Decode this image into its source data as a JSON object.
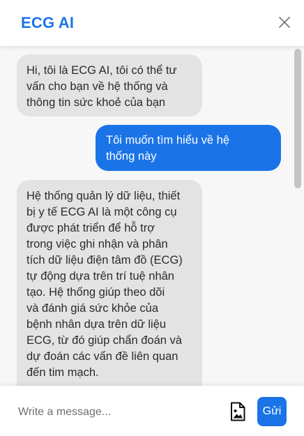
{
  "header": {
    "title": "ECG AI",
    "close_icon": "close-icon"
  },
  "colors": {
    "accent": "#1a74e8",
    "bot_bubble": "#e3e3e3",
    "chat_background": "#f7f7f7"
  },
  "messages": [
    {
      "sender": "bot",
      "lines": [
        "Hi, tôi là ECG AI, tôi có thể tư",
        "vấn cho bạn về hệ thống và",
        "thông tin sức khoẻ của bạn"
      ]
    },
    {
      "sender": "user",
      "lines": [
        "Tôi muốn tìm hiểu về hệ",
        "thống này"
      ]
    },
    {
      "sender": "bot",
      "lines": [
        "Hệ thống quản lý dữ liệu, thiết",
        "bị y tế ECG AI là một công cụ",
        "được phát triển để hỗ trợ",
        "trong việc ghi nhận và phân",
        "tích dữ liệu điện tâm đồ (ECG)",
        "tự động dựa trên trí tuệ nhân",
        "tạo. Hệ thống giúp theo dõi",
        "và đánh giá sức khỏe của",
        "bệnh nhân dựa trên dữ liệu",
        "ECG, từ đó giúp chẩn đoán và",
        "dự đoán các vấn đề liên quan",
        "đến tim mạch."
      ]
    }
  ],
  "composer": {
    "placeholder": "Write a message...",
    "value": "",
    "attach_icon": "image-file-icon",
    "send_label": "Gửi"
  }
}
